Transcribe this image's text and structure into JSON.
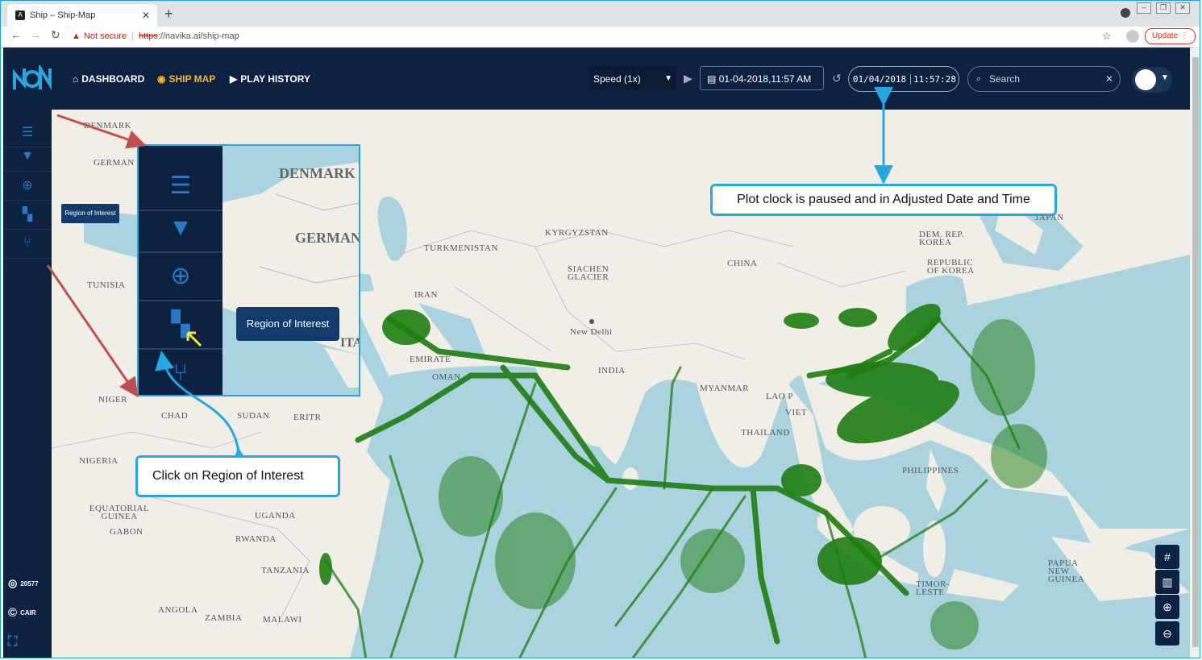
{
  "browser": {
    "tab_title": "Ship – Ship-Map",
    "tab_close": "✕",
    "new_tab": "+",
    "not_secure": "Not secure",
    "url_scheme": "https",
    "url_rest": "://navika.ai/ship-map",
    "update_label": "Update"
  },
  "header": {
    "menu": [
      {
        "label": "DASHBOARD"
      },
      {
        "label": "SHIP MAP"
      },
      {
        "label": "PLAY HISTORY"
      }
    ],
    "speed_value": "Speed (1x)",
    "datetime_value": "01-04-2018,11:57 AM",
    "clock_date": "01/04/2018",
    "clock_time": "11:57:28",
    "search_placeholder": "Search"
  },
  "sidebar": {
    "tooltip": "Region of Interest",
    "counter": "20577",
    "cair_label": "CAIR"
  },
  "map_labels": {
    "denmark": "DENMARK",
    "germany": "GERMAN",
    "tunisia": "TUNISIA",
    "niger": "NIGER",
    "chad": "CHAD",
    "sudan": "SUDAN",
    "eritrea": "ERITR",
    "nigeria": "NIGERIA",
    "eq_guinea": "EQUATORIAL GUINEA",
    "gabon": "GABON",
    "uganda": "UGANDA",
    "rwanda": "RWANDA",
    "tanzania": "TANZANIA",
    "angola": "ANGOLA",
    "zambia": "ZAMBIA",
    "malawi": "MALAWI",
    "turkmenistan": "TURKMENISTAN",
    "kyrgyzstan": "KYRGYZSTAN",
    "iran": "IRAN",
    "siachen": "SIACHEN GLACIER",
    "new_delhi": "New Delhi",
    "india": "INDIA",
    "emirates": "EMIRATE",
    "oman": "OMAN",
    "china": "CHINA",
    "dem_rep_korea": "DEM. REP. KOREA",
    "rep_korea": "REPUBLIC OF KOREA",
    "japan": "JAPAN",
    "myanmar": "MYANMAR",
    "lao": "LAO P",
    "vietnam": "VIET",
    "thailand": "THAILAND",
    "philippines": "PHILIPPINES",
    "timor": "TIMOR-LESTE",
    "png": "PAPUA NEW GUINEA"
  },
  "inset": {
    "label_denmark": "DENMARK",
    "label_german": "GERMAN",
    "label_ita": "ITA",
    "roi_button": "Region of Interest"
  },
  "callouts": {
    "clock_note": "Plot clock is paused and in Adjusted Date and Time",
    "roi_note": "Click on Region of Interest"
  },
  "colors": {
    "header_bg": "#0c2240",
    "accent_active": "#f5b62c",
    "ship_green": "#1f7d12",
    "sea": "#aad3df",
    "callout_border": "#25a8e0",
    "arrow_red": "#c0504d"
  }
}
